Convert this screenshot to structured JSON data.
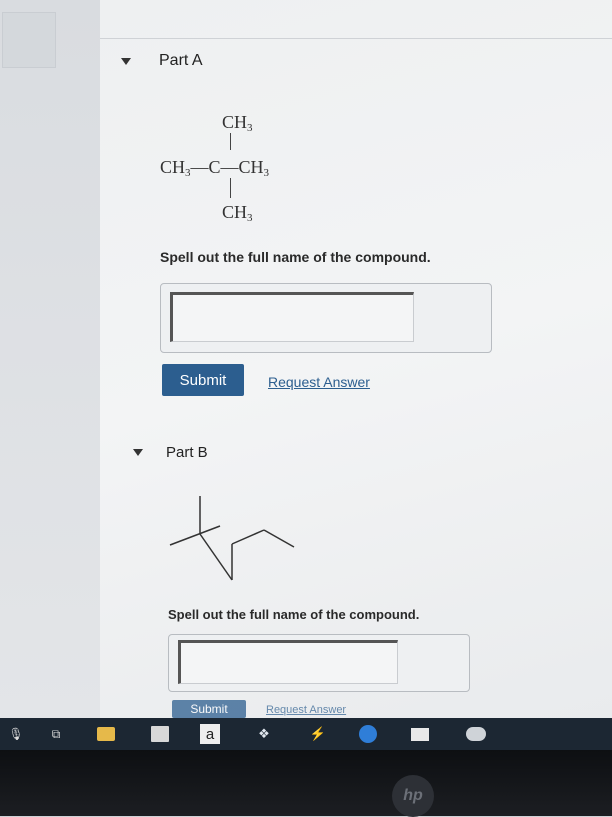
{
  "part_a": {
    "title": "Part A",
    "structure": {
      "top": "CH",
      "top_sub": "3",
      "left": "CH",
      "left_sub": "3",
      "dash1": "—",
      "center": "C",
      "dash2": "—",
      "right": "CH",
      "right_sub": "3",
      "bottom": "CH",
      "bottom_sub": "3"
    },
    "question": "Spell out the full name of the compound.",
    "input_value": "",
    "submit_label": "Submit",
    "request_label": "Request Answer"
  },
  "part_b": {
    "title": "Part B",
    "question": "Spell out the full name of the compound.",
    "input_value": "",
    "submit_label": "Submit",
    "request_label": "Request Answer"
  },
  "taskbar": {
    "icons": [
      "file-explorer-icon",
      "store-icon",
      "amazon-icon",
      "dropbox-icon",
      "app-icon",
      "edge-icon",
      "mail-icon",
      "app2-icon"
    ],
    "amazon_glyph": "a"
  },
  "colors": {
    "button": "#2c5e8f",
    "link": "#2c5e8f",
    "taskbar": "#1c2733"
  }
}
